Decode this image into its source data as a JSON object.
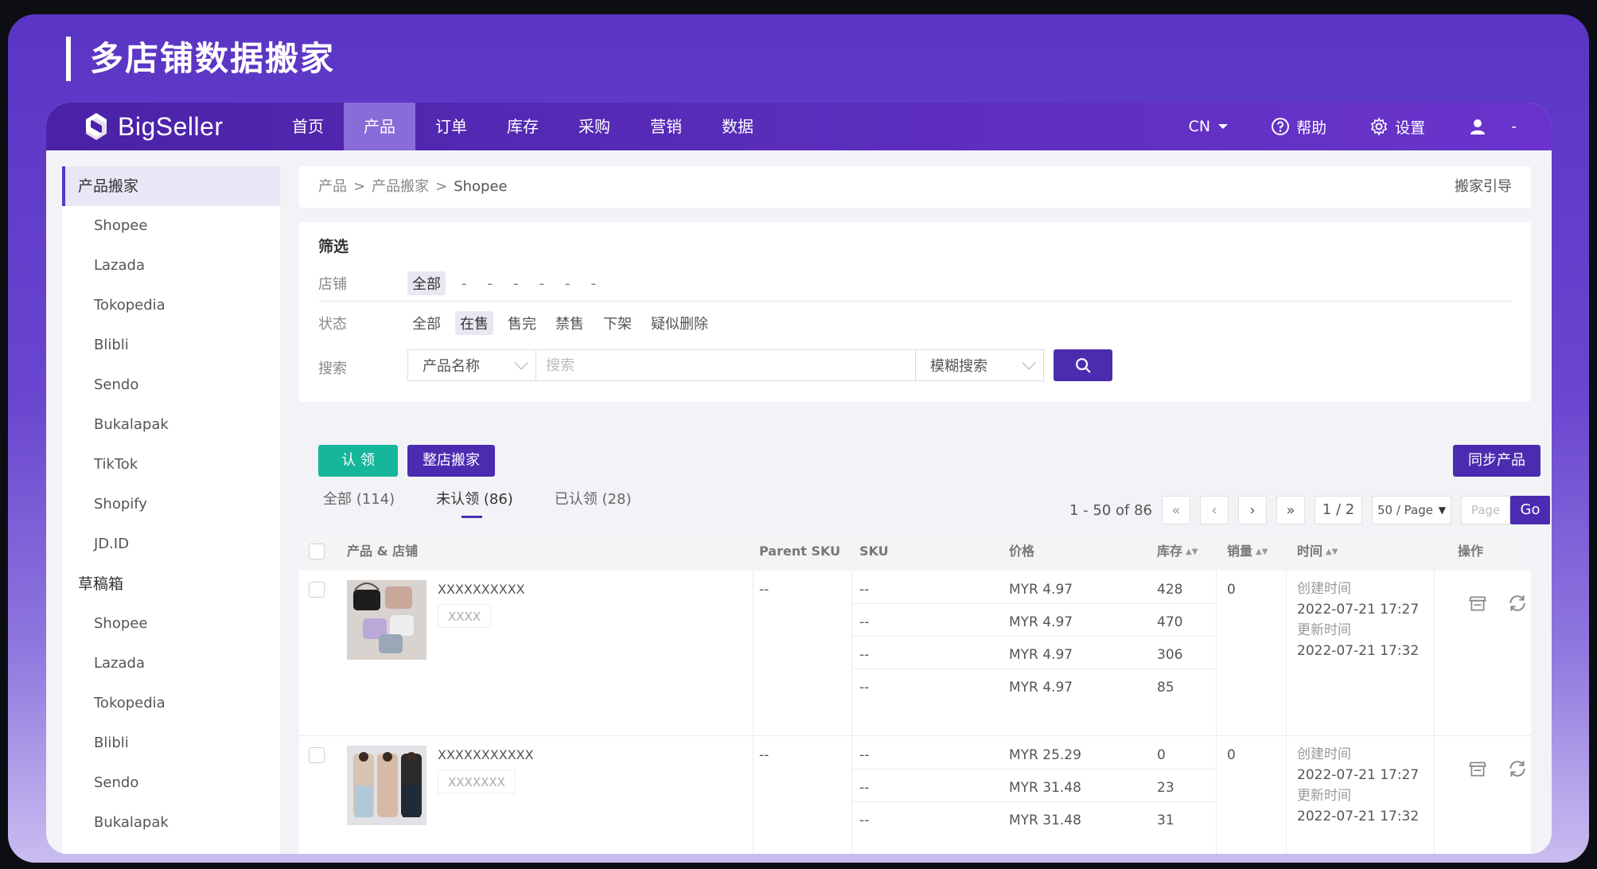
{
  "banner": {
    "title": "多店铺数据搬家"
  },
  "brand": {
    "name": "BigSeller"
  },
  "nav": {
    "items": [
      "首页",
      "产品",
      "订单",
      "库存",
      "采购",
      "营销",
      "数据"
    ],
    "active_index": 1,
    "lang": "CN",
    "help": "帮助",
    "settings": "设置",
    "user": "-"
  },
  "sidebar": {
    "groups": [
      {
        "label": "产品搬家",
        "active": true,
        "items": [
          "Shopee",
          "Lazada",
          "Tokopedia",
          "Blibli",
          "Sendo",
          "Bukalapak",
          "TikTok",
          "Shopify",
          "JD.ID"
        ]
      },
      {
        "label": "草稿箱",
        "active": false,
        "items": [
          "Shopee",
          "Lazada",
          "Tokopedia",
          "Blibli",
          "Sendo",
          "Bukalapak"
        ]
      }
    ]
  },
  "breadcrumb": {
    "items": [
      "产品",
      "产品搬家",
      "Shopee"
    ],
    "separator": ">",
    "guide": "搬家引导"
  },
  "filter": {
    "title": "筛选",
    "store_label": "店铺",
    "store_chips": [
      "全部",
      "-",
      "-",
      "-",
      "-",
      "-",
      "-"
    ],
    "status_label": "状态",
    "status_chips": [
      "全部",
      "在售",
      "售完",
      "禁售",
      "下架",
      "疑似删除"
    ],
    "status_selected": 1,
    "search_label": "搜索",
    "search_field": "产品名称",
    "search_placeholder": "搜索",
    "search_mode": "模糊搜索"
  },
  "actions": {
    "claim": "认 领",
    "whole_store": "整店搬家",
    "sync": "同步产品"
  },
  "tabs": [
    {
      "label": "全部 (114)",
      "active": false
    },
    {
      "label": "未认领 (86)",
      "active": true
    },
    {
      "label": "已认领 (28)",
      "active": false
    }
  ],
  "pagination": {
    "range": "1 - 50 of 86",
    "page": "1 / 2",
    "page_size": "50 / Page",
    "page_placeholder": "Page",
    "go": "Go"
  },
  "table": {
    "headers": {
      "product": "产品 & 店铺",
      "parent_sku": "Parent SKU",
      "sku": "SKU",
      "price": "价格",
      "stock": "库存",
      "sales": "销量",
      "time": "时间",
      "ops": "操作"
    },
    "created_label": "创建时间",
    "updated_label": "更新时间",
    "rows": [
      {
        "name": "XXXXXXXXXX",
        "tag": "XXXX",
        "parent_sku": "--",
        "sales": "0",
        "created": "2022-07-21 17:27",
        "updated": "2022-07-21 17:32",
        "variants": [
          {
            "sku": "--",
            "price": "MYR 4.97",
            "stock": "428"
          },
          {
            "sku": "--",
            "price": "MYR 4.97",
            "stock": "470"
          },
          {
            "sku": "--",
            "price": "MYR 4.97",
            "stock": "306"
          },
          {
            "sku": "--",
            "price": "MYR 4.97",
            "stock": "85"
          }
        ]
      },
      {
        "name": "XXXXXXXXXXX",
        "tag": "XXXXXXX",
        "parent_sku": "--",
        "sales": "0",
        "created": "2022-07-21 17:27",
        "updated": "2022-07-21 17:32",
        "variants": [
          {
            "sku": "--",
            "price": "MYR 25.29",
            "stock": "0"
          },
          {
            "sku": "--",
            "price": "MYR 31.48",
            "stock": "23"
          },
          {
            "sku": "--",
            "price": "MYR 31.48",
            "stock": "31"
          }
        ]
      }
    ]
  },
  "colors": {
    "brand_purple": "#4b2cb0",
    "claim_green": "#16b69a",
    "nav_active": "#8a6cd8"
  }
}
